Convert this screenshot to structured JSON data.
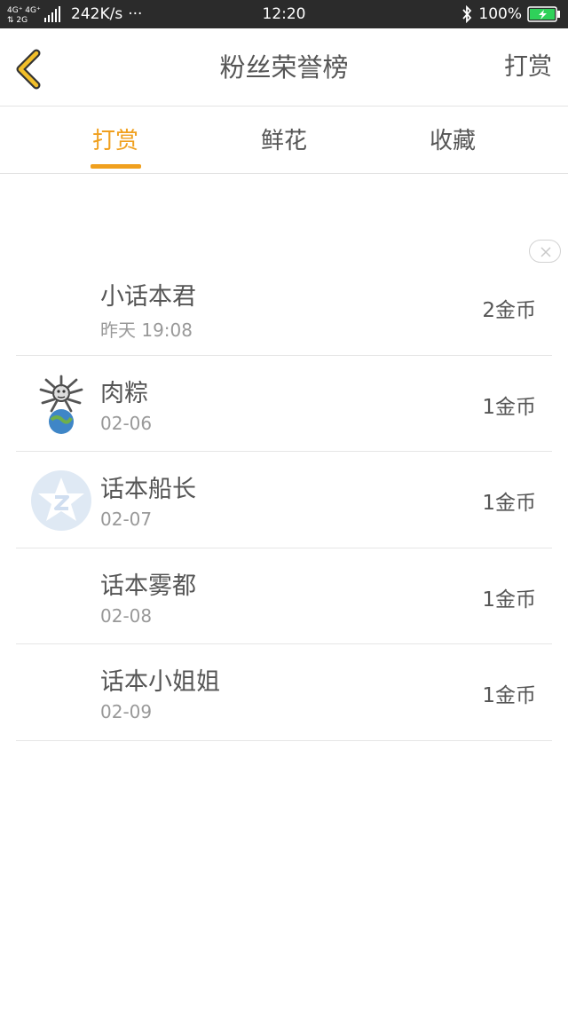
{
  "status_bar": {
    "network": "4G 4G 2G",
    "speed": "242K/s",
    "more": "···",
    "time": "12:20",
    "bluetooth_icon": "bluetooth-icon",
    "battery_percent": "100%",
    "battery_color": "#2fd15a"
  },
  "header": {
    "back_icon": "chevron-left-icon",
    "title": "粉丝荣誉榜",
    "action_label": "打赏"
  },
  "accent_color": "#f0a01e",
  "tabs": [
    {
      "label": "打赏",
      "active": true
    },
    {
      "label": "鲜花",
      "active": false
    },
    {
      "label": "收藏",
      "active": false
    }
  ],
  "close_icon": "close-icon",
  "rows": [
    {
      "name": "小话本君",
      "date": "昨天 19:08",
      "amount": "2金币",
      "avatar": "none"
    },
    {
      "name": "肉粽",
      "date": "02-06",
      "amount": "1金币",
      "avatar": "cartoon-avatar-icon"
    },
    {
      "name": "话本船长",
      "date": "02-07",
      "amount": "1金币",
      "avatar": "qq-star-avatar-icon"
    },
    {
      "name": "话本雾都",
      "date": "02-08",
      "amount": "1金币",
      "avatar": "none"
    },
    {
      "name": "话本小姐姐",
      "date": "02-09",
      "amount": "1金币",
      "avatar": "none"
    }
  ]
}
